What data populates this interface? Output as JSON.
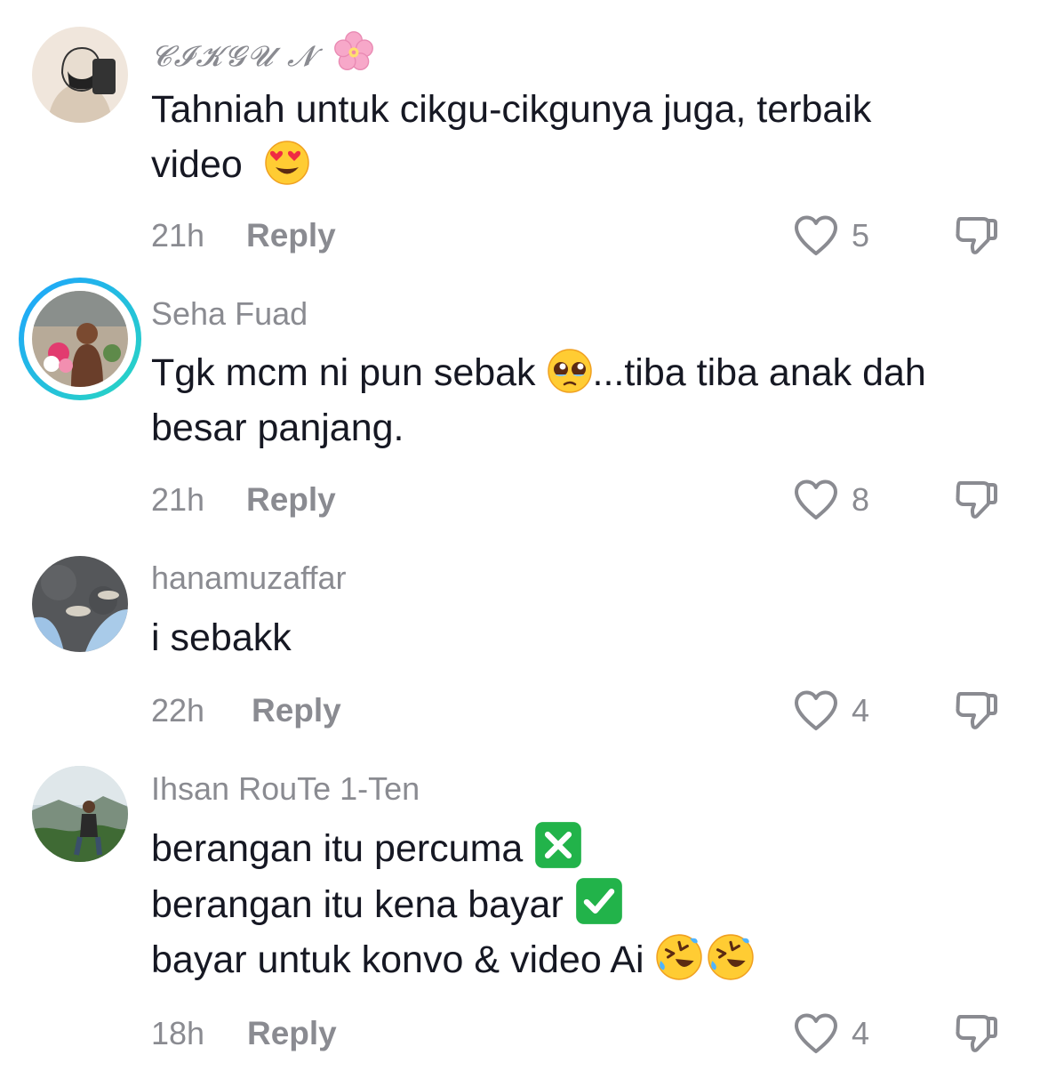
{
  "comments": [
    {
      "username": "𝓒𝓘𝓚𝓖𝓤 𝓝",
      "username_emoji": "cherry-blossom-icon",
      "lines": [
        "Tahniah untuk cikgu-cikgunya juga, terbaik",
        "video"
      ],
      "time": "21h",
      "reply_label": "Reply",
      "likes": "5"
    },
    {
      "username": "Seha Fuad",
      "lines": [
        "Tgk mcm ni pun sebak",
        "...tiba tiba anak dah",
        "besar panjang."
      ],
      "time": "21h",
      "reply_label": "Reply",
      "likes": "8"
    },
    {
      "username": "hanamuzaffar",
      "lines": [
        "i sebakk"
      ],
      "time": "22h",
      "reply_label": "Reply",
      "likes": "4"
    },
    {
      "username": "Ihsan RouTe 1-Ten",
      "lines": [
        "berangan itu percuma",
        "berangan itu kena bayar",
        "bayar untuk konvo & video Ai"
      ],
      "time": "18h",
      "reply_label": "Reply",
      "likes": "4"
    }
  ],
  "colors": {
    "text": "#161823",
    "muted": "#8a8b91",
    "story_ring_start": "#1ea3ff",
    "story_ring_end": "#29d7c0"
  }
}
